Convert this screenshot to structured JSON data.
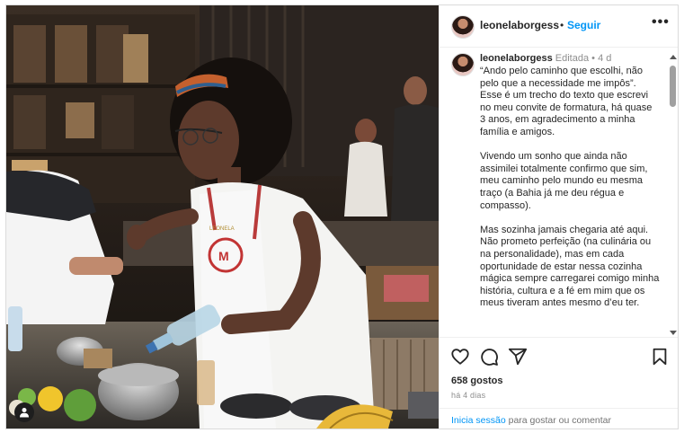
{
  "post": {
    "username": "leonelaborgess",
    "follow_label": "Seguir",
    "header_separator": "•"
  },
  "caption": {
    "username": "leonelaborgess",
    "edited_label": "Editada",
    "separator": "•",
    "time": "4 d",
    "text": "“Ando pelo caminho que escolhi, não pelo que a necessidade me impôs”. Esse é um trecho do texto que escrevi no meu convite de formatura, há quase 3 anos, em agradecimento a minha família e amigos.\n\nVivendo um sonho que ainda não assimilei totalmente confirmo que sim, meu caminho pelo mundo eu mesma traço (a Bahia já me deu régua e compasso).\n\nMas sozinha jamais chegaria até aqui. Não prometo perfeição (na culinária ou na personalidade), mas em cada oportunidade de estar nessa cozinha mágica sempre carregarei comigo minha história, cultura e a fé em mim que os meus tiveram antes mesmo d’eu ter."
  },
  "photo": {
    "apron_name": "LEONELA"
  },
  "engagement": {
    "likes": "658 gostos",
    "date": "há 4 dias"
  },
  "login": {
    "link": "Inicia sessão",
    "suffix": " para gostar ou comentar"
  },
  "colors": {
    "link": "#0095f6",
    "muted": "#8e8e8e",
    "text": "#262626",
    "border": "#dbdbdb"
  },
  "icons": [
    "more-options-icon",
    "heart-icon",
    "comment-icon",
    "share-icon",
    "bookmark-icon",
    "user-tag-icon"
  ]
}
